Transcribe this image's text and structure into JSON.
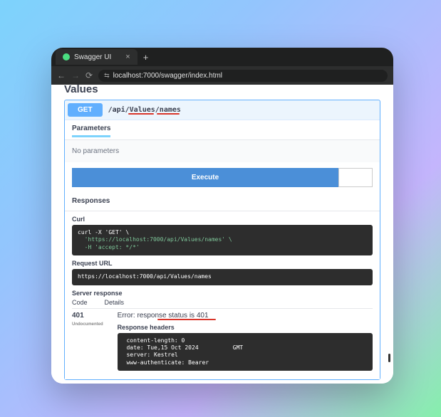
{
  "browser": {
    "tab_title": "Swagger UI",
    "url": "localhost:7000/swagger/index.html"
  },
  "page": {
    "section_title": "Values",
    "operation": {
      "method": "GET",
      "path": "/api/Values/names"
    },
    "parameters_tab": "Parameters",
    "no_parameters": "No parameters",
    "execute_label": "Execute",
    "responses_label": "Responses",
    "curl": {
      "label": "Curl",
      "line1": "curl -X 'GET' \\",
      "line2": "  'https://localhost:7000/api/Values/names' \\",
      "line3": "  -H 'accept: */*'"
    },
    "request_url": {
      "label": "Request URL",
      "value": "https://localhost:7000/api/Values/names"
    },
    "server_response_label": "Server response",
    "code_header": "Code",
    "details_header": "Details",
    "response": {
      "code": "401",
      "undocumented": "Undocumented",
      "error": "Error: response status is 401",
      "response_headers_label": "Response headers",
      "headers": " content-length: 0 \n date: Tue,15 Oct 2024          GMT \n server: Kestrel \n www-authenticate: Bearer "
    }
  }
}
